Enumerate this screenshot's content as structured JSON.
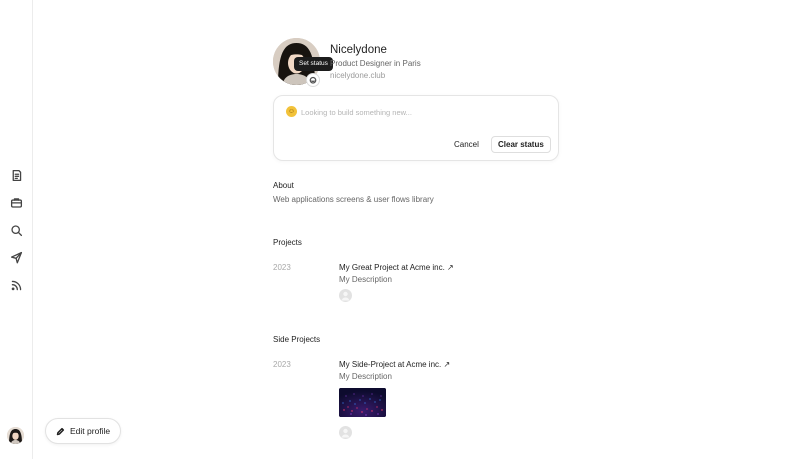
{
  "sidebar": {
    "items": [
      {
        "name": "notes-icon"
      },
      {
        "name": "briefcase-icon"
      },
      {
        "name": "search-icon"
      },
      {
        "name": "send-icon"
      },
      {
        "name": "rss-icon"
      }
    ]
  },
  "edit_profile": {
    "label": "Edit profile"
  },
  "profile": {
    "name": "Nicelydone",
    "role": "Product Designer in Paris",
    "site": "nicelydone.club",
    "tooltip": "Set status"
  },
  "status": {
    "emoji": "☺",
    "placeholder": "Looking to build something new...",
    "value": "",
    "cancel_label": "Cancel",
    "clear_label": "Clear status"
  },
  "about": {
    "title": "About",
    "text": "Web applications screens & user flows library"
  },
  "projects": {
    "title": "Projects",
    "items": [
      {
        "year": "2023",
        "title": "My Great Project at Acme inc. ↗",
        "description": "My Description"
      }
    ]
  },
  "side_projects": {
    "title": "Side Projects",
    "items": [
      {
        "year": "2023",
        "title": "My Side-Project at Acme inc. ↗",
        "description": "My Description"
      }
    ]
  },
  "colors": {
    "accent_emoji": "#f2c23a",
    "tooltip_bg": "#1c1c1c",
    "thumb_bg": "#120f3a"
  }
}
